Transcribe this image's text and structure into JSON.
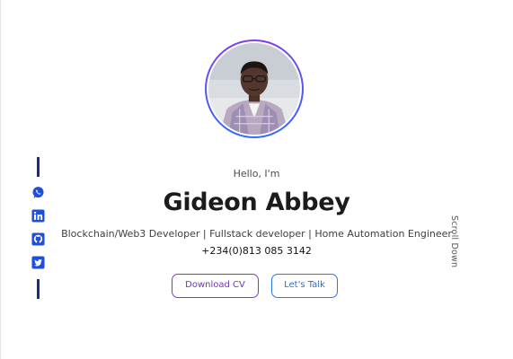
{
  "hero": {
    "greeting": "Hello, I'm",
    "name": "Gideon Abbey",
    "roles": "Blockchain/Web3 Developer | Fullstack developer | Home Automation Engineer",
    "phone": "+234(0)813 085 3142"
  },
  "buttons": {
    "download_cv": "Download CV",
    "lets_talk": "Let's Talk"
  },
  "socials": [
    {
      "icon": "whatsapp-icon"
    },
    {
      "icon": "linkedin-icon"
    },
    {
      "icon": "github-icon"
    },
    {
      "icon": "twitter-icon"
    }
  ],
  "scroll_label": "Scroll Down",
  "colors": {
    "accent_purple": "#7d3cc8",
    "accent_blue": "#2a7be0",
    "social_blue": "#1a2a8a"
  }
}
